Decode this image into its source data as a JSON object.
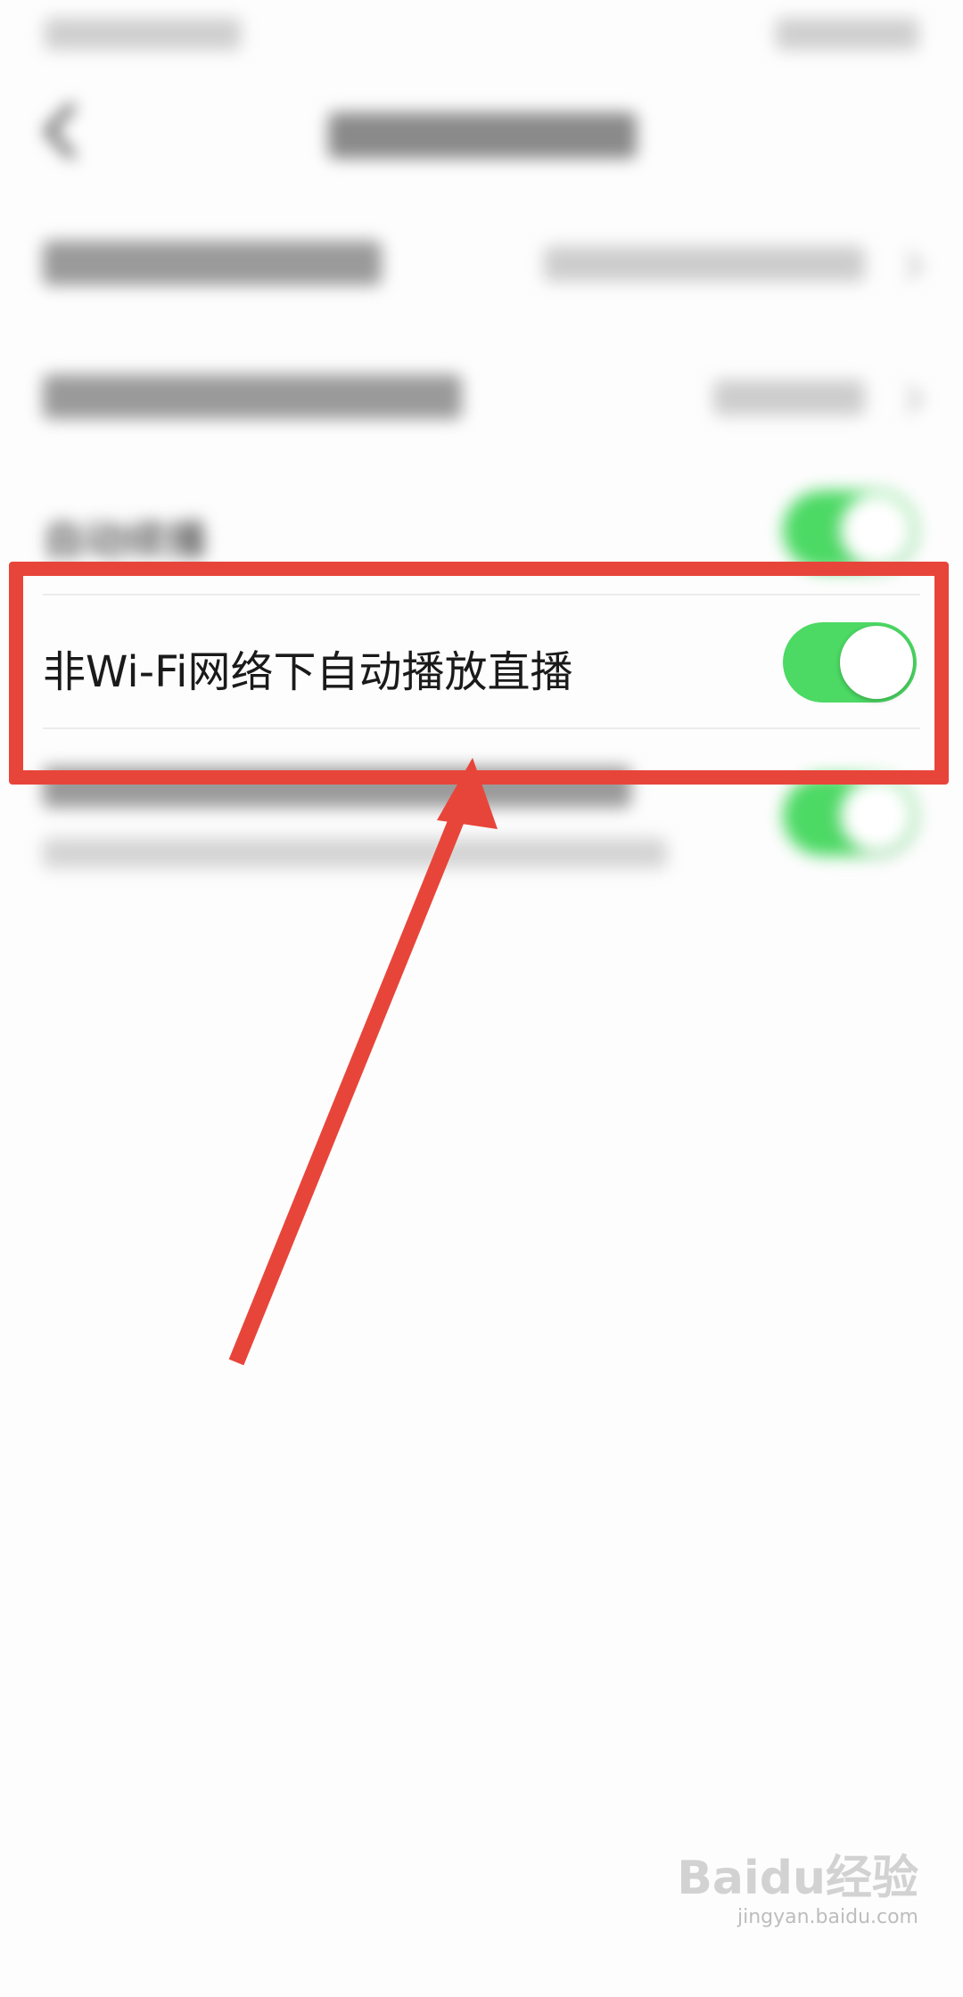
{
  "status_bar": {
    "left_text": "",
    "right_text": ""
  },
  "nav": {
    "title": ""
  },
  "settings": {
    "rows_blurred": [
      {
        "label": "",
        "value": ""
      },
      {
        "label": "",
        "value": ""
      },
      {
        "label": "自动续播",
        "toggle_on": true
      }
    ],
    "highlighted_row": {
      "label": "非Wi-Fi网络下自动播放直播",
      "toggle_on": true
    },
    "last_row": {
      "label": "",
      "sub": "",
      "toggle_on": true
    }
  },
  "colors": {
    "toggle_on": "#4cd964",
    "annotation": "#e8453a",
    "background": "#fdfdfd"
  },
  "watermark": {
    "main": "Baidu经验",
    "sub": "jingyan.baidu.com"
  }
}
